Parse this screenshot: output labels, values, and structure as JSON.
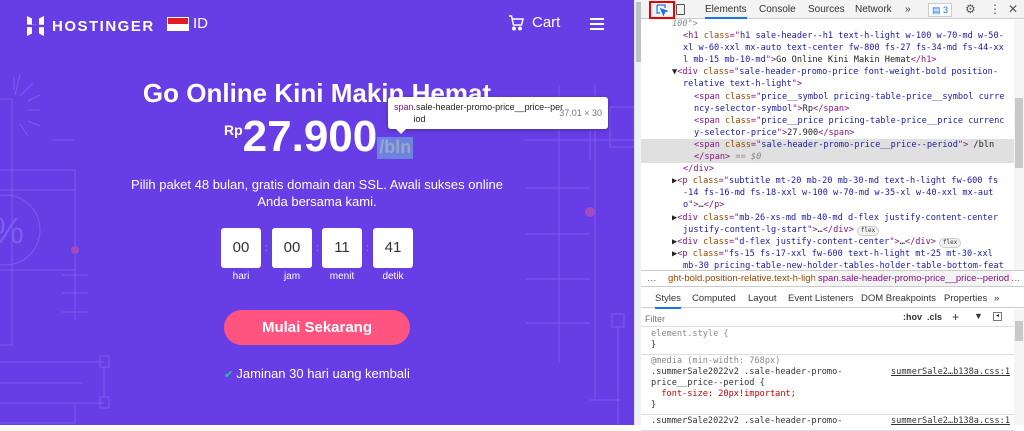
{
  "page": {
    "brand": "HOSTINGER",
    "lang": "ID",
    "cart": "Cart",
    "title": "Go Online Kini Makin Hemat",
    "price_symbol": "Rp",
    "price": "27.900",
    "period": "/bln",
    "subtitle": "Pilih paket 48 bulan, gratis domain dan SSL. Awali sukses online Anda bersama kami.",
    "countdown": [
      {
        "value": "00",
        "label": "hari"
      },
      {
        "value": "00",
        "label": "jam"
      },
      {
        "value": "11",
        "label": "menit"
      },
      {
        "value": "41",
        "label": "detik"
      }
    ],
    "cta": "Mulai Sekarang",
    "guarantee": "Jaminan 30 hari uang kembali",
    "colors": {
      "bg": "#673de6",
      "cta": "#ff5480"
    }
  },
  "tooltip": {
    "tag": "span",
    "cls": ".sale-header-promo-price__price--period",
    "size": "37.01 × 30"
  },
  "devtools": {
    "tabs": [
      "Elements",
      "Console",
      "Sources",
      "Network"
    ],
    "more": "»",
    "issues": "3",
    "dom_lines": [
      {
        "i": 5,
        "sel": false,
        "tok": [
          [
            "c",
            "100\">"
          ]
        ]
      },
      {
        "i": 6,
        "sel": false,
        "tok": [
          [
            "t",
            "<h1 "
          ],
          [
            "a",
            "class"
          ],
          [
            "t",
            "=\""
          ],
          [
            "v",
            "h1 sale-header--h1 text-h-light w-100 w-70-md w-50-"
          ]
        ]
      },
      {
        "i": 6,
        "sel": false,
        "tok": [
          [
            "v",
            "xl w-60-xxl mx-auto text-center fw-800 fs-27 fs-34-md fs-44-xx"
          ]
        ]
      },
      {
        "i": 6,
        "sel": false,
        "tok": [
          [
            "v",
            "l mb-15 mb-10-md"
          ],
          [
            "t",
            "\">"
          ],
          [
            "x",
            "Go Online Kini Makin Hemat"
          ],
          [
            "t",
            "</h1>"
          ]
        ]
      },
      {
        "i": 5,
        "sel": false,
        "tok": [
          [
            "x",
            "▼"
          ],
          [
            "t",
            "<div "
          ],
          [
            "a",
            "class"
          ],
          [
            "t",
            "=\""
          ],
          [
            "v",
            "sale-header-promo-price font-weight-bold position-"
          ]
        ]
      },
      {
        "i": 6,
        "sel": false,
        "tok": [
          [
            "v",
            "relative text-h-light"
          ],
          [
            "t",
            "\">"
          ]
        ]
      },
      {
        "i": 7,
        "sel": false,
        "tok": [
          [
            "t",
            "<span "
          ],
          [
            "a",
            "class"
          ],
          [
            "t",
            "=\""
          ],
          [
            "v",
            "price__symbol pricing-table-price__symbol curre"
          ]
        ]
      },
      {
        "i": 7,
        "sel": false,
        "tok": [
          [
            "v",
            "ncy-selector-symbol"
          ],
          [
            "t",
            "\">"
          ],
          [
            "x",
            "Rp"
          ],
          [
            "t",
            "</span>"
          ]
        ]
      },
      {
        "i": 7,
        "sel": false,
        "tok": [
          [
            "t",
            "<span "
          ],
          [
            "a",
            "class"
          ],
          [
            "t",
            "=\""
          ],
          [
            "v",
            "price__price pricing-table-price__price currenc"
          ]
        ]
      },
      {
        "i": 7,
        "sel": false,
        "tok": [
          [
            "v",
            "y-selector-price"
          ],
          [
            "t",
            "\">"
          ],
          [
            "x",
            "27.900"
          ],
          [
            "t",
            "</span>"
          ]
        ]
      },
      {
        "i": 7,
        "sel": true,
        "tok": [
          [
            "t",
            "<span "
          ],
          [
            "a",
            "class"
          ],
          [
            "t",
            "=\""
          ],
          [
            "v",
            "sale-header-promo-price__price--period"
          ],
          [
            "t",
            "\">"
          ],
          [
            "x",
            " /bln"
          ]
        ]
      },
      {
        "i": 7,
        "sel": true,
        "tok": [
          [
            "t",
            "</span>"
          ],
          [
            "c",
            " == $0"
          ]
        ]
      },
      {
        "i": 6,
        "sel": false,
        "tok": [
          [
            "t",
            "</div>"
          ]
        ]
      },
      {
        "i": 5,
        "sel": false,
        "tok": [
          [
            "x",
            "▶"
          ],
          [
            "t",
            "<p "
          ],
          [
            "a",
            "class"
          ],
          [
            "t",
            "=\""
          ],
          [
            "v",
            "subtitle mt-20 mb-20 mb-30-md text-h-light fw-600 fs"
          ]
        ]
      },
      {
        "i": 6,
        "sel": false,
        "tok": [
          [
            "v",
            "-14 fs-16-md fs-18-xxl w-100 w-70-md w-35-xl w-40-xxl mx-aut"
          ]
        ]
      },
      {
        "i": 6,
        "sel": false,
        "tok": [
          [
            "v",
            "o"
          ],
          [
            "t",
            "\">"
          ],
          [
            "x",
            "…"
          ],
          [
            "t",
            "</p>"
          ]
        ]
      },
      {
        "i": 5,
        "sel": false,
        "tok": [
          [
            "x",
            "▶"
          ],
          [
            "t",
            "<div "
          ],
          [
            "a",
            "class"
          ],
          [
            "t",
            "=\""
          ],
          [
            "v",
            "mb-26-xs-md mb-40-md d-flex justify-content-center"
          ]
        ]
      },
      {
        "i": 6,
        "sel": false,
        "tok": [
          [
            "v",
            "justify-content-lg-start"
          ],
          [
            "t",
            "\">"
          ],
          [
            "x",
            "…"
          ],
          [
            "t",
            "</div>"
          ]
        ],
        "pill": "flex"
      },
      {
        "i": 5,
        "sel": false,
        "tok": [
          [
            "x",
            "▶"
          ],
          [
            "t",
            "<div "
          ],
          [
            "a",
            "class"
          ],
          [
            "t",
            "=\""
          ],
          [
            "v",
            "d-flex justify-content-center"
          ],
          [
            "t",
            "\">"
          ],
          [
            "x",
            "…"
          ],
          [
            "t",
            "</div>"
          ]
        ],
        "pill": "flex"
      },
      {
        "i": 5,
        "sel": false,
        "tok": [
          [
            "x",
            "▶"
          ],
          [
            "t",
            "<p "
          ],
          [
            "a",
            "class"
          ],
          [
            "t",
            "=\""
          ],
          [
            "v",
            "fs-15 fs-17-xxl fw-600 text-h-light mt-25 mt-30-xxl"
          ]
        ]
      },
      {
        "i": 6,
        "sel": false,
        "tok": [
          [
            "v",
            "mb-30 pricing-table-new-holder-tables-holder-table-bottom-feat"
          ]
        ]
      }
    ],
    "breadcrumb": [
      "…",
      "ght-bold.position-relative.text-h-light",
      "span.sale-header-promo-price__price--period",
      "…"
    ],
    "style_tabs": [
      "Styles",
      "Computed",
      "Layout",
      "Event Listeners",
      "DOM Breakpoints",
      "Properties",
      "»"
    ],
    "filter_placeholder": "Filter",
    "filter_tools": [
      ":hov",
      ".cls",
      "+"
    ],
    "rules": [
      {
        "lines": [
          "element.style {",
          "}"
        ],
        "src": ""
      },
      {
        "lines": [
          "@media (min-width: 768px)",
          ".summerSale2022v2 .sale-header-promo-",
          "price__price--period {",
          "  font-size: 20px!important;",
          "}"
        ],
        "src": "summerSale2…b138a.css:1"
      },
      {
        "lines": [
          ".summerSale2022v2 .sale-header-promo-"
        ],
        "src": "summerSale2…b138a.css:1"
      }
    ]
  }
}
